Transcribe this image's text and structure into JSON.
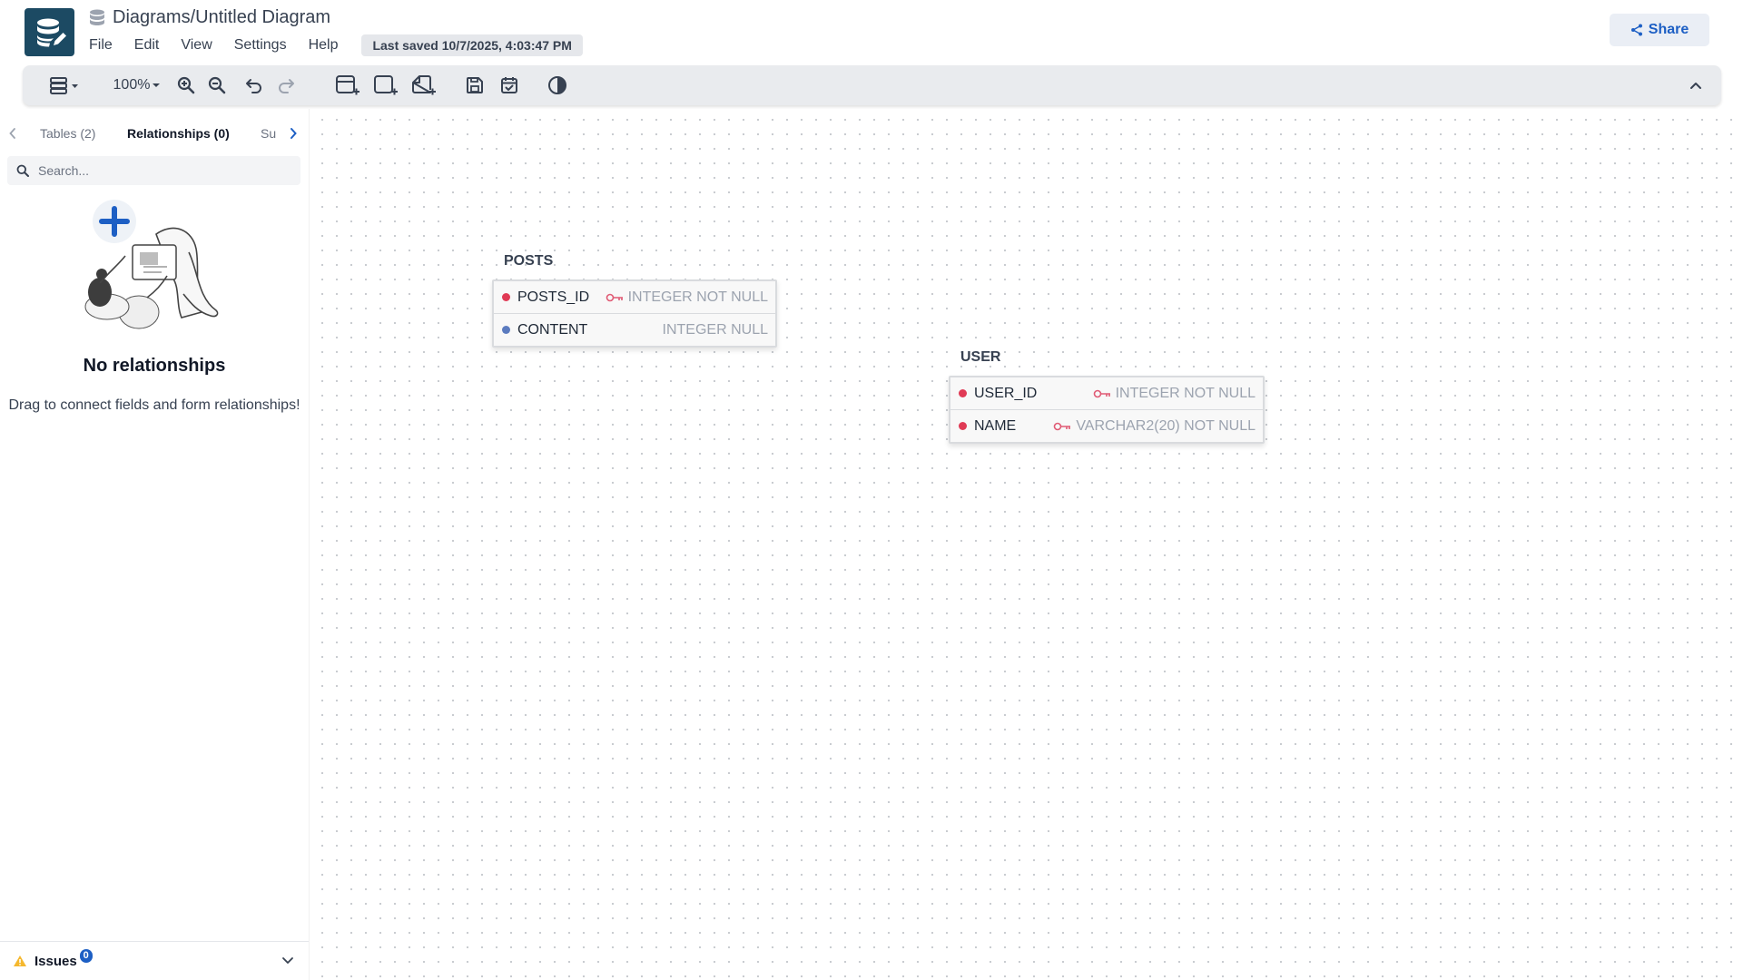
{
  "header": {
    "title": "Diagrams/Untitled Diagram",
    "menu": [
      {
        "label": "File"
      },
      {
        "label": "Edit"
      },
      {
        "label": "View"
      },
      {
        "label": "Settings"
      },
      {
        "label": "Help"
      }
    ],
    "last_saved": "Last saved 10/7/2025, 4:03:47 PM",
    "share_label": "Share",
    "icons": {
      "logo": "database-edit-icon",
      "title": "database-icon",
      "share": "share-icon"
    }
  },
  "toolbar": {
    "zoom_level": "100%",
    "icons": [
      "layout-icon",
      "zoom-in-icon",
      "zoom-out-icon",
      "undo-icon",
      "redo-icon",
      "add-table-icon",
      "add-area-icon",
      "add-note-icon",
      "save-icon",
      "todo-icon",
      "theme-icon",
      "collapse-icon"
    ]
  },
  "sidebar": {
    "tabs": [
      {
        "label": "Tables (2)",
        "active": false
      },
      {
        "label": "Relationships (0)",
        "active": true
      },
      {
        "label": "Su",
        "active": false
      }
    ],
    "search": {
      "placeholder": "Search...",
      "value": ""
    },
    "empty_state": {
      "title": "No relationships",
      "description": "Drag to connect fields and form relationships!"
    },
    "issues": {
      "label": "Issues",
      "count": "0"
    }
  },
  "canvas": {
    "tables": [
      {
        "name": "POSTS",
        "fields": [
          {
            "name": "POSTS_ID",
            "type": "INTEGER NOT NULL",
            "primary_key": true,
            "dot_color": "#e03a55"
          },
          {
            "name": "CONTENT",
            "type": "INTEGER NULL",
            "primary_key": false,
            "dot_color": "#5b7bbf"
          }
        ]
      },
      {
        "name": "USER",
        "fields": [
          {
            "name": "USER_ID",
            "type": "INTEGER NOT NULL",
            "primary_key": true,
            "dot_color": "#e03a55"
          },
          {
            "name": "NAME",
            "type": "VARCHAR2(20) NOT NULL",
            "primary_key": true,
            "dot_color": "#e03a55"
          }
        ]
      }
    ]
  },
  "colors": {
    "accent": "#1d5fc4",
    "key": "#e05a74",
    "logo_bg": "#1c4a63",
    "issue_warning": "#f5b82e"
  }
}
